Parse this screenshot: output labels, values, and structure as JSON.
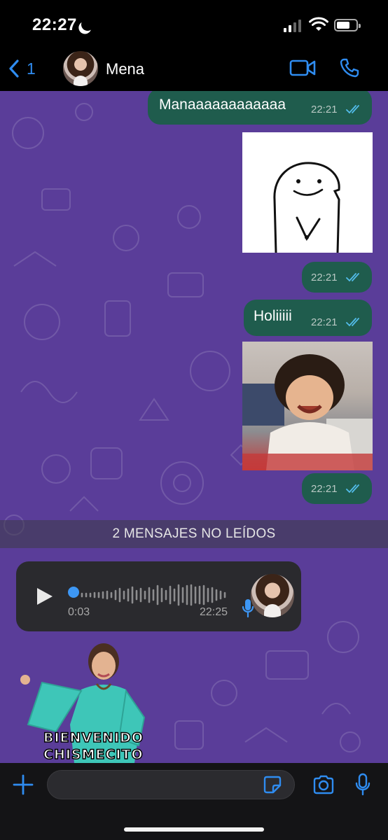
{
  "status_bar": {
    "time": "22:27",
    "battery_level": 0.7
  },
  "header": {
    "back_count": "1",
    "contact_name": "Mena"
  },
  "messages": [
    {
      "type": "text",
      "text": "Manaaaaaaaaaaaa",
      "time": "22:21"
    },
    {
      "type": "image",
      "content": "sticker-drawing",
      "time": "22:21"
    },
    {
      "type": "text",
      "text": "Holiiiii",
      "time": "22:21"
    },
    {
      "type": "image",
      "content": "laughing-child-photo",
      "time": "22:21"
    }
  ],
  "unread_banner": "2 MENSAJES NO LEÍDOS",
  "voice_note": {
    "progress": "0:03",
    "time": "22:25"
  },
  "sticker": {
    "line1": "BIENVENIDO",
    "line2": "CHISMECITO"
  },
  "composer": {
    "placeholder": ""
  },
  "colors": {
    "accent": "#2f8cf0",
    "chat_background": "#5a3d99",
    "outgoing_bubble": "#1f5c4d",
    "tick_blue": "#53bdeb"
  }
}
